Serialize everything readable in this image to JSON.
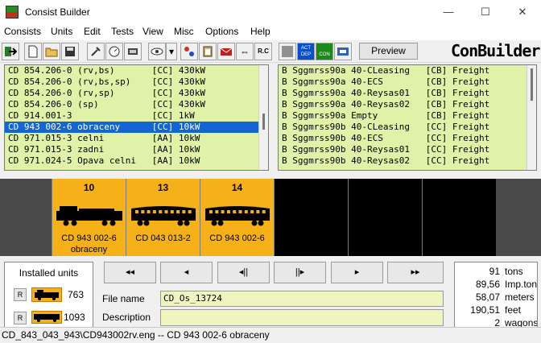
{
  "window": {
    "title": "Consist Builder"
  },
  "menu": [
    "Consists",
    "Units",
    "Edit",
    "Tests",
    "View",
    "Misc",
    "Options",
    "Help"
  ],
  "toolbar": {
    "preview_label": "Preview",
    "rc_label": "R.C",
    "act_dep_label": "ACT DEP",
    "con_label": "CON",
    "brand": "ConBuilder"
  },
  "left_list": {
    "rows": [
      "CD 854.206-0 (rv,bs)       [CC] 430kW",
      "CD 854.206-0 (rv,bs,sp)    [CC] 430kW",
      "CD 854.206-0 (rv,sp)       [CC] 430kW",
      "CD 854.206-0 (sp)          [CC] 430kW",
      "CD 914.001-3               [CC] 1kW",
      "CD 943 002-6 obraceny      [CC] 10kW",
      "CD 971.015-3 celni         [AA] 10kW",
      "CD 971.015-3 zadni         [AA] 10kW",
      "CD 971.024-5 Opava celni   [AA] 10kW"
    ],
    "selected_index": 5
  },
  "right_list": {
    "rows": [
      "B Sggmrss90a 40-CLeasing   [CB] Freight",
      "B Sggmrss90a 40-ECS        [CB] Freight",
      "B Sggmrss90a 40-Reysas01   [CB] Freight",
      "B Sggmrss90a 40-Reysas02   [CB] Freight",
      "B Sggmrss90a Empty         [CB] Freight",
      "B Sggmrss90b 40-CLeasing   [CC] Freight",
      "B Sggmrss90b 40-ECS        [CC] Freight",
      "B Sggmrss90b 40-Reysas01   [CC] Freight",
      "B Sggmrss90b 40-Reysas02   [CC] Freight"
    ]
  },
  "consist": {
    "slots": [
      {
        "number": "10",
        "line1": "CD 943 002-6",
        "line2": "obraceny",
        "kind": "loco"
      },
      {
        "number": "13",
        "line1": "CD 043 013-2",
        "line2": "",
        "kind": "coach"
      },
      {
        "number": "14",
        "line1": "CD 943 002-6",
        "line2": "",
        "kind": "coach"
      },
      {
        "number": "",
        "line1": "",
        "line2": "",
        "kind": "empty"
      },
      {
        "number": "",
        "line1": "",
        "line2": "",
        "kind": "empty"
      },
      {
        "number": "",
        "line1": "",
        "line2": "",
        "kind": "empty"
      }
    ],
    "active_color": "#f5b117"
  },
  "installed_units": {
    "title": "Installed units",
    "r_label": "R",
    "engines_count": "763",
    "wagons_count": "1093"
  },
  "navigation": {
    "first": "◂◂",
    "prev": "◂",
    "prev_unit": "◂||",
    "next_unit": "||▸",
    "next": "▸",
    "last": "▸▸"
  },
  "file": {
    "name_label": "File name",
    "name_value": "CD_Os_13724",
    "description_label": "Description",
    "description_value": ""
  },
  "stats": [
    {
      "value": "91",
      "unit": "tons"
    },
    {
      "value": "89,56",
      "unit": "Imp.ton"
    },
    {
      "value": "58,07",
      "unit": "meters"
    },
    {
      "value": "190,51",
      "unit": "feet"
    },
    {
      "value": "2",
      "unit": "wagons"
    }
  ],
  "status_bar": "CD_843_043_943\\CD943002rv.eng -- CD 943 002-6 obraceny"
}
